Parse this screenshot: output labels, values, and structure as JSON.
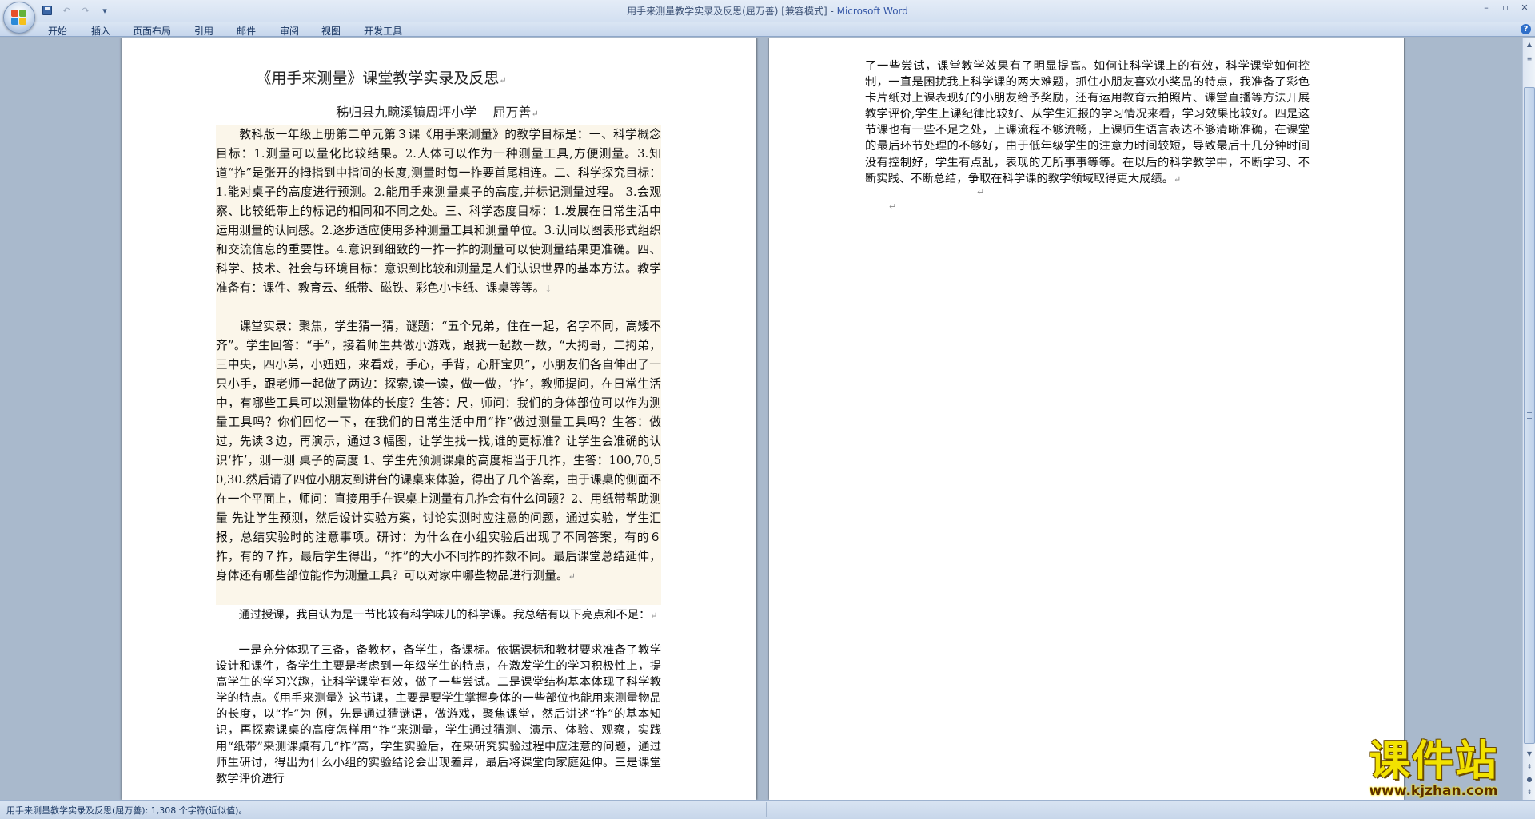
{
  "window": {
    "title": "用手来测量教学实录及反思(屈万善) [兼容模式] - ",
    "app_name": "Microsoft Word"
  },
  "qat": {
    "undo": "↶",
    "redo": "↷",
    "customize": "▾"
  },
  "window_controls": {
    "minimize": "–",
    "restore": "▫",
    "close": "✕"
  },
  "ribbon": {
    "tabs": [
      "开始",
      "插入",
      "页面布局",
      "引用",
      "邮件",
      "审阅",
      "视图",
      "开发工具"
    ],
    "help": "?"
  },
  "document": {
    "title": "《用手来测量》课堂教学实录及反思",
    "author": "秭归县九畹溪镇周坪小学    屈万善",
    "paragraphs": [
      "教科版一年级上册第二单元第３课《用手来测量》的教学目标是：一、科学概念目标：1.测量可以量化比较结果。2.人体可以作为一种测量工具,方便测量。3.知道“拃”是张开的拇指到中指间的长度,测量时每一拃要首尾相连。二、科学探究目标：1.能对桌子的高度进行预测。2.能用手来测量桌子的高度,并标记测量过程。 3.会观察、比较纸带上的标记的相同和不同之处。三、科学态度目标：1.发展在日常生活中运用测量的认同感。2.逐步适应使用多种测量工具和测量单位。3.认同以图表形式组织和交流信息的重要性。4.意识到细致的一拃一拃的测量可以使测量结果更准确。四、科学、技术、社会与环境目标：意识到比较和测量是人们认识世界的基本方法。教学准备有：课件、教育云、纸带、磁铁、彩色小卡纸、课桌等等。",
      "课堂实录：聚焦，学生猜一猜，谜题：“五个兄弟，住在一起，名字不同，高矮不齐”。学生回答：“手”，接着师生共做小游戏，跟我一起数一数，“大拇哥，二拇弟，三中央，四小弟，小妞妞，来看戏，手心，手背，心肝宝贝”，小朋友们各自伸出了一只小手，跟老师一起做了两边：探索,读一读，做一做，‘拃’，教师提问，在日常生活中，有哪些工具可以测量物体的长度？生答：尺，师问：我们的身体部位可以作为测量工具吗？你们回忆一下，在我们的日常生活中用“拃”做过测量工具吗？生答：做过，先读３边，再演示，通过３幅图，让学生找一找,谁的更标准？让学生会准确的认识‘拃’，测一测 桌子的高度 1、学生先预测课桌的高度相当于几拃，生答：100,70,50,30.然后请了四位小朋友到讲台的课桌来体验，得出了几个答案，由于课桌的侧面不在一个平面上，师问：直接用手在课桌上测量有几拃会有什么问题？2、用纸带帮助测量 先让学生预测，然后设计实验方案，讨论实测时应注意的问题，通过实验，学生汇报，总结实验时的注意事项。研讨：为什么在小组实验后出现了不同答案，有的６拃，有的７拃，最后学生得出，“拃”的大小不同拃的拃数不同。最后课堂总结延伸，身体还有哪些部位能作为测量工具？可以对家中哪些物品进行测量。",
      "通过授课，我自认为是一节比较有科学味儿的科学课。我总结有以下亮点和不足：",
      "一是充分体现了三备，备教材，备学生，备课标。依据课标和教材要求准备了教学设计和课件，备学生主要是考虑到一年级学生的特点，在激发学生的学习积极性上，提高学生的学习兴趣，让科学课堂有效，做了一些尝试。二是课堂结构基本体现了科学教学的特点。《用手来测量》这节课，主要是要学生掌握身体的一些部位也能用来测量物品的长度，以“拃”为 例，先是通过猜谜语，做游戏，聚焦课堂，然后讲述“拃”的基本知识，再探索课桌的高度怎样用“拃”来测量，学生通过猜测、演示、体验、观察，实践用“纸带”来测课桌有几“拃”高，学生实验后，在来研究实验过程中应注意的问题，通过师生研讨，得出为什么小组的实验结论会出现差异，最后将课堂向家庭延伸。三是课堂教学评价进行"
    ],
    "page2_text": "了一些尝试，课堂教学效果有了明显提高。如何让科学课上的有效，科学课堂如何控制，一直是困扰我上科学课的两大难题，抓住小朋友喜欢小奖品的特点，我准备了彩色卡片纸对上课表现好的小朋友给予奖励，还有运用教育云拍照片、课堂直播等方法开展教学评价,学生上课纪律比较好、从学生汇报的学习情况来看，学习效果比较好。四是这节课也有一些不足之处，上课流程不够流畅，上课师生语言表达不够清晰准确，在课堂的最后环节处理的不够好，由于低年级学生的注意力时间较短，导致最后十几分钟时间没有控制好，学生有点乱，表现的无所事事等等。在以后的科学教学中，不断学习、不断实践、不断总结，争取在科学课的教学领域取得更大成绩。"
  },
  "marks": {
    "paragraph": "↵",
    "line_break": "↓"
  },
  "scrollbar": {
    "up": "▲",
    "down": "▼",
    "prev_page": "⇞",
    "next_page": "⇟",
    "browse": "●"
  },
  "status": {
    "text": "用手来测量教学实录及反思(屈万善): 1,308 个字符(近似值)。"
  },
  "watermark": {
    "main": "课件站",
    "url": "www.kjzhan.com"
  }
}
